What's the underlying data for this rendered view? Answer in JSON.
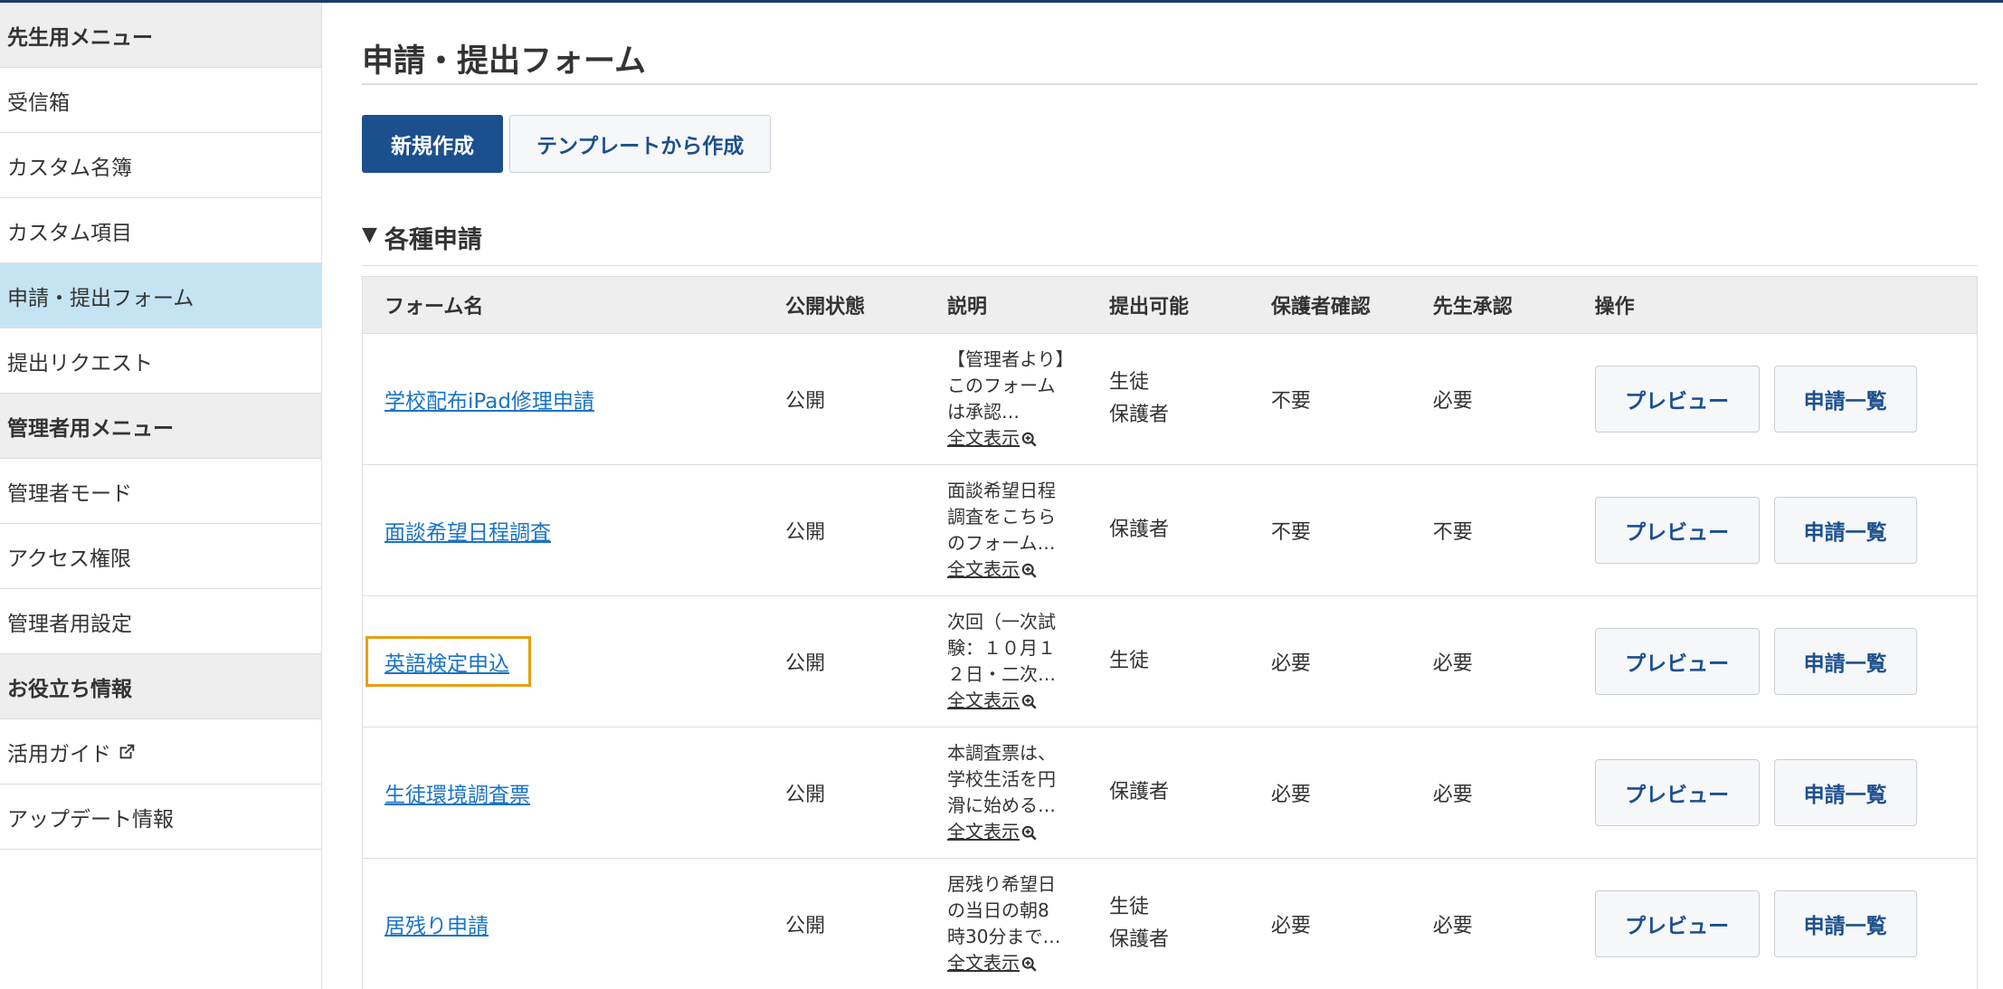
{
  "sidebar": {
    "items": [
      {
        "label": "先生用メニュー",
        "type": "header"
      },
      {
        "label": "受信箱",
        "type": "link"
      },
      {
        "label": "カスタム名簿",
        "type": "link"
      },
      {
        "label": "カスタム項目",
        "type": "link"
      },
      {
        "label": "申請・提出フォーム",
        "type": "active"
      },
      {
        "label": "提出リクエスト",
        "type": "link"
      },
      {
        "label": "管理者用メニュー",
        "type": "header"
      },
      {
        "label": "管理者モード",
        "type": "link"
      },
      {
        "label": "アクセス権限",
        "type": "link"
      },
      {
        "label": "管理者用設定",
        "type": "link"
      },
      {
        "label": "お役立ち情報",
        "type": "header"
      },
      {
        "label": "活用ガイド",
        "type": "external"
      },
      {
        "label": "アップデート情報",
        "type": "link"
      }
    ]
  },
  "main": {
    "title": "申請・提出フォーム",
    "new_button": "新規作成",
    "template_button": "テンプレートから作成",
    "section": {
      "triangle": "▼",
      "title": "各種申請"
    },
    "table": {
      "headers": [
        "フォーム名",
        "公開状態",
        "説明",
        "提出可能",
        "保護者確認",
        "先生承認",
        "操作"
      ],
      "full_text_label": "全文表示",
      "preview_label": "プレビュー",
      "list_label": "申請一覧",
      "rows": [
        {
          "name": "学校配布iPad修理申請",
          "status": "公開",
          "desc": "【管理者より】このフォームは承認…",
          "submitters": [
            "生徒",
            "保護者"
          ],
          "guardian": "不要",
          "teacher": "必要",
          "highlighted": false
        },
        {
          "name": "面談希望日程調査",
          "status": "公開",
          "desc": "面談希望日程調査をこちらのフォーム…",
          "submitters": [
            "保護者"
          ],
          "guardian": "不要",
          "teacher": "不要",
          "highlighted": false
        },
        {
          "name": "英語検定申込",
          "status": "公開",
          "desc": "次回（一次試験：１０月１２日・二次…",
          "submitters": [
            "生徒"
          ],
          "guardian": "必要",
          "teacher": "必要",
          "highlighted": true
        },
        {
          "name": "生徒環境調査票",
          "status": "公開",
          "desc": "本調査票は、学校生活を円滑に始める…",
          "submitters": [
            "保護者"
          ],
          "guardian": "必要",
          "teacher": "必要",
          "highlighted": false
        },
        {
          "name": "居残り申請",
          "status": "公開",
          "desc": "居残り希望日の当日の朝8時30分まで…",
          "submitters": [
            "生徒",
            "保護者"
          ],
          "guardian": "必要",
          "teacher": "必要",
          "highlighted": false
        }
      ]
    }
  },
  "colors": {
    "accent": "#1b4f8e",
    "active_bg": "#c5e4f3",
    "link": "#1a73c4",
    "highlight": "#e8a013"
  }
}
